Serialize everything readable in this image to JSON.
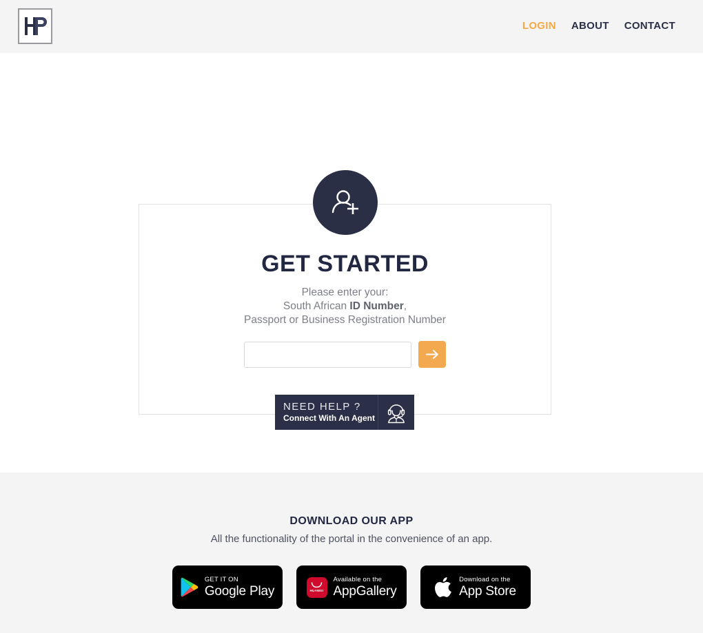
{
  "header": {
    "logo_text": "HP",
    "logo_alt": "hp-logo",
    "nav": [
      {
        "label": "LOGIN",
        "active": true
      },
      {
        "label": "ABOUT",
        "active": false
      },
      {
        "label": "CONTACT",
        "active": false
      }
    ]
  },
  "main": {
    "avatar_icon": "user-plus-icon",
    "title": "GET STARTED",
    "subtitle_line1": "Please enter your:",
    "subtitle_line2_prefix": "South African ",
    "subtitle_line2_bold": "ID Number",
    "subtitle_line2_suffix": ",",
    "subtitle_line3": "Passport or Business Registration Number",
    "input_value": "",
    "input_placeholder": "",
    "submit_icon": "arrow-right-icon"
  },
  "help_widget": {
    "title": "NEED HELP ?",
    "subtitle": "Connect With An Agent",
    "icon": "support-agent-icon"
  },
  "footer": {
    "title": "DOWNLOAD OUR APP",
    "subtitle": "All the functionality of the portal in the convenience of an app.",
    "badges": [
      {
        "small": "GET IT ON",
        "big": "Google Play",
        "icon": "google-play-icon"
      },
      {
        "small": "Available on the",
        "big": "AppGallery",
        "icon": "huawei-appgallery-icon",
        "logo_word": "HUAWEI"
      },
      {
        "small": "Download on the",
        "big": "App Store",
        "icon": "apple-icon"
      }
    ]
  },
  "colors": {
    "accent_orange": "#f5a845",
    "dark_navy": "#2b2f46",
    "band_gray": "#f4f4f4",
    "huawei_red": "#cf0a2c"
  }
}
